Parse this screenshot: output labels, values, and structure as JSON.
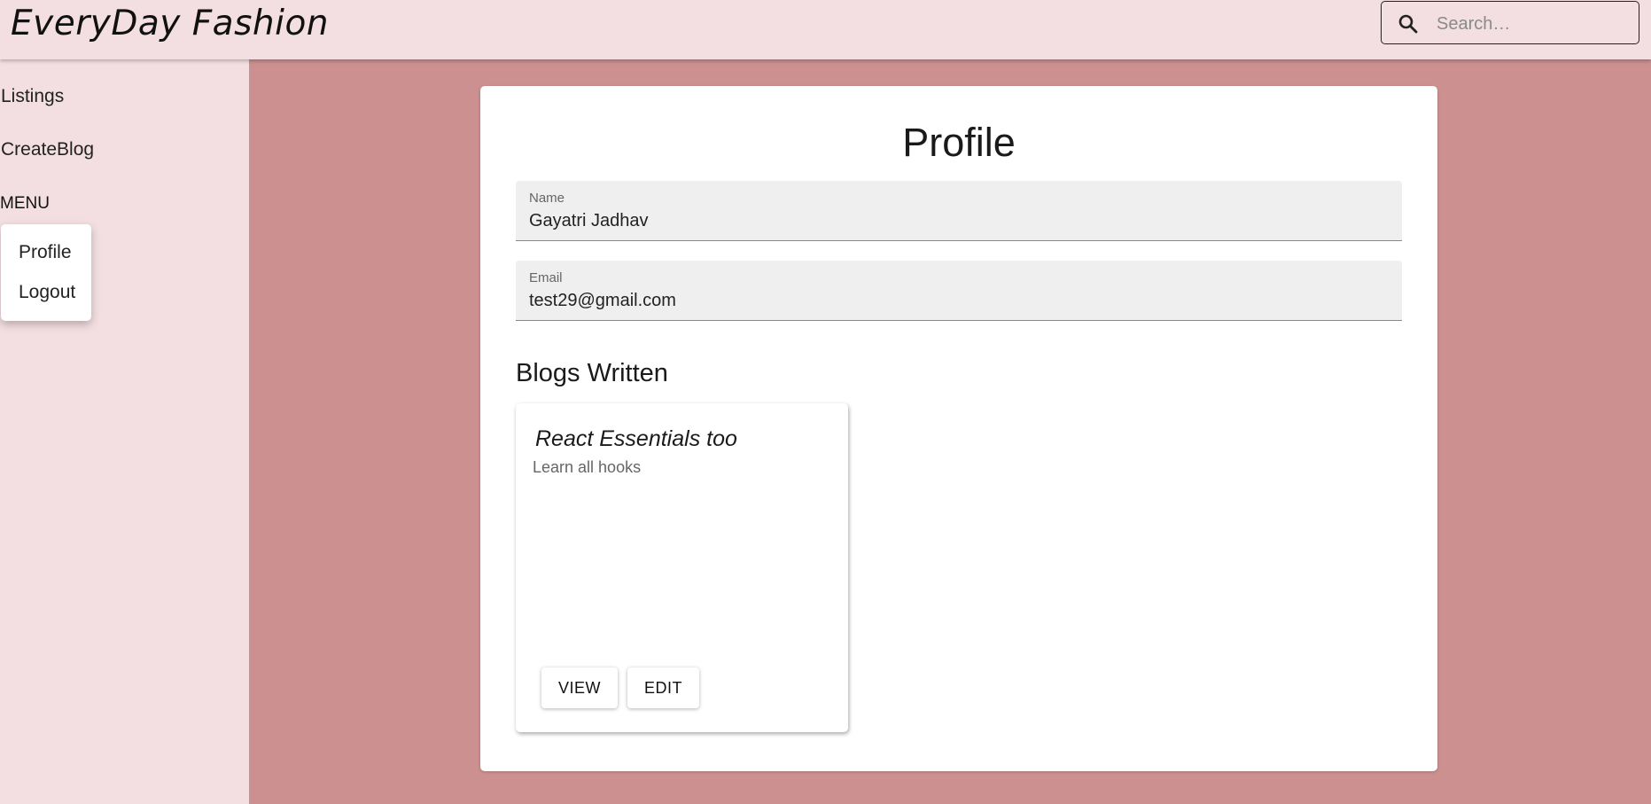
{
  "app": {
    "brand": "EveryDay Fashion"
  },
  "search": {
    "placeholder": "Search…"
  },
  "sidebar": {
    "items": [
      {
        "label": "Listings"
      },
      {
        "label": "CreateBlog"
      }
    ],
    "menu_label": "MENU",
    "menu_items": [
      {
        "label": "Profile"
      },
      {
        "label": "Logout"
      }
    ]
  },
  "profile": {
    "title": "Profile",
    "name_label": "Name",
    "name_value": "Gayatri Jadhav",
    "email_label": "Email",
    "email_value": "test29@gmail.com",
    "blogs_title": "Blogs Written",
    "blogs": [
      {
        "title": "React Essentials too",
        "description": "Learn all hooks",
        "view_label": "VIEW",
        "edit_label": "EDIT"
      }
    ]
  },
  "icons": {
    "search": "search-icon"
  },
  "colors": {
    "appbar": "#f3dfe1",
    "background": "#cc9090",
    "card": "#ffffff",
    "field": "#efefef"
  }
}
